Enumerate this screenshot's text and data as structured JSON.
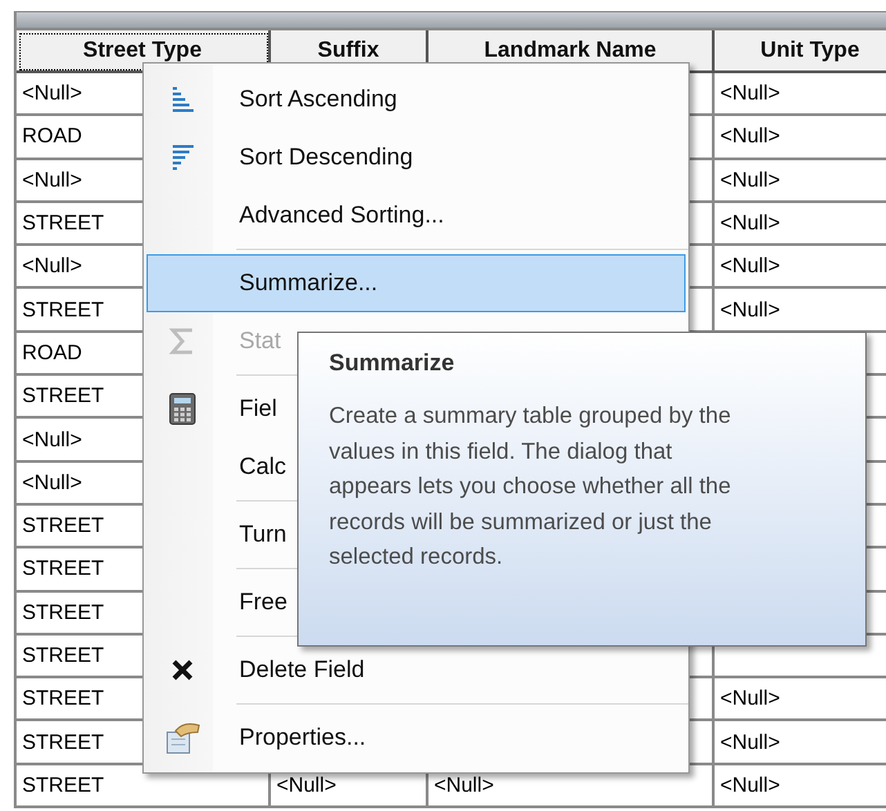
{
  "table": {
    "columns": [
      "Street Type",
      "Suffix",
      "Landmark Name",
      "Unit Type"
    ],
    "rows": [
      {
        "street_type": "<Null>",
        "unit_type": "<Null>"
      },
      {
        "street_type": "ROAD",
        "unit_type": "<Null>"
      },
      {
        "street_type": "<Null>",
        "unit_type": "<Null>"
      },
      {
        "street_type": "STREET",
        "unit_type": "<Null>"
      },
      {
        "street_type": "<Null>",
        "unit_type": "<Null>"
      },
      {
        "street_type": "STREET",
        "unit_type": "<Null>"
      },
      {
        "street_type": "ROAD"
      },
      {
        "street_type": "STREET"
      },
      {
        "street_type": "<Null>"
      },
      {
        "street_type": "<Null>"
      },
      {
        "street_type": "STREET"
      },
      {
        "street_type": "STREET"
      },
      {
        "street_type": "STREET"
      },
      {
        "street_type": "STREET"
      },
      {
        "street_type": "STREET",
        "unit_type": "<Null>"
      },
      {
        "street_type": "STREET",
        "unit_type": "<Null>"
      },
      {
        "street_type": "STREET",
        "suffix": "<Null>",
        "landmark_name": "<Null>",
        "unit_type": "<Null>"
      }
    ]
  },
  "context_menu": {
    "items": [
      {
        "kind": "item",
        "label": "Sort Ascending",
        "selected": false,
        "disabled": false
      },
      {
        "kind": "item",
        "label": "Sort Descending",
        "selected": false,
        "disabled": false
      },
      {
        "kind": "item",
        "label": "Advanced Sorting...",
        "selected": false,
        "disabled": false
      },
      {
        "kind": "separator"
      },
      {
        "kind": "item",
        "label": "Summarize...",
        "selected": true,
        "disabled": false
      },
      {
        "kind": "item",
        "label": "Stat",
        "selected": false,
        "disabled": true
      },
      {
        "kind": "separator"
      },
      {
        "kind": "item",
        "label": "Fiel",
        "selected": false,
        "disabled": false
      },
      {
        "kind": "item",
        "label": "Calc",
        "selected": false,
        "disabled": false
      },
      {
        "kind": "separator"
      },
      {
        "kind": "item",
        "label": "Turn",
        "selected": false,
        "disabled": false
      },
      {
        "kind": "separator"
      },
      {
        "kind": "item",
        "label": "Free",
        "selected": false,
        "disabled": false
      },
      {
        "kind": "separator"
      },
      {
        "kind": "item",
        "label": "Delete Field",
        "selected": false,
        "disabled": false
      },
      {
        "kind": "separator"
      },
      {
        "kind": "item",
        "label": "Properties...",
        "selected": false,
        "disabled": false
      }
    ]
  },
  "tooltip": {
    "title": "Summarize",
    "text": "Create a summary table grouped by the values in this field. The dialog that appears lets you choose whether all the records will be summarized or just the selected records."
  }
}
